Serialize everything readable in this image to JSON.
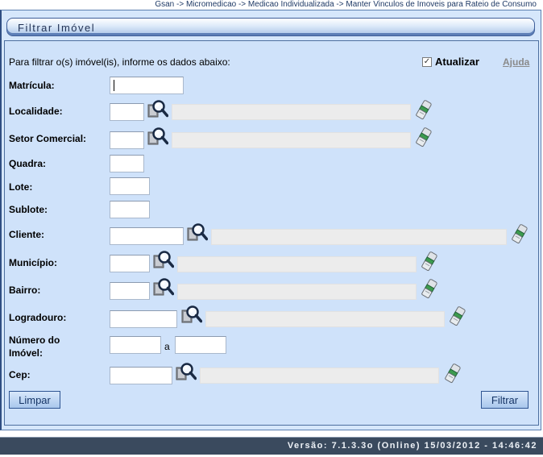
{
  "breadcrumb": "Gsan -> Micromedicao -> Medicao Individualizada -> Manter Vinculos de Imoveis para Rateio de Consumo",
  "panel_title": "Filtrar Imóvel",
  "intro_text": "Para filtrar o(s) imóvel(is), informe os dados abaixo:",
  "refresh": {
    "label": "Atualizar",
    "checked": true,
    "check_glyph": "✓"
  },
  "help_label": "Ajuda",
  "fields": {
    "matricula": {
      "label": "Matrícula:",
      "value": ""
    },
    "localidade": {
      "label": "Localidade:",
      "code": "",
      "description": ""
    },
    "setor_comercial": {
      "label": "Setor Comercial:",
      "code": "",
      "description": ""
    },
    "quadra": {
      "label": "Quadra:",
      "value": ""
    },
    "lote": {
      "label": "Lote:",
      "value": ""
    },
    "sublote": {
      "label": "Sublote:",
      "value": ""
    },
    "cliente": {
      "label": "Cliente:",
      "code": "",
      "description": ""
    },
    "municipio": {
      "label": "Município:",
      "code": "",
      "description": ""
    },
    "bairro": {
      "label": "Bairro:",
      "code": "",
      "description": ""
    },
    "logradouro": {
      "label": "Logradouro:",
      "code": "",
      "description": ""
    },
    "numero_imovel": {
      "label_line1": "Número do",
      "label_line2": "Imóvel:",
      "from": "",
      "separator": "a",
      "to": ""
    },
    "cep": {
      "label": "Cep:",
      "code": "",
      "description": ""
    }
  },
  "buttons": {
    "clear": "Limpar",
    "filter": "Filtrar"
  },
  "footer_version": "Versão: 7.1.3.3o (Online) 15/03/2012 - 14:46:42",
  "icons": {
    "search": "magnifier-icon",
    "clear": "eraser-icon"
  },
  "colors": {
    "panel_bg": "#cfe2fa",
    "border": "#2f5592",
    "footer_bg": "#3a4a5e"
  }
}
